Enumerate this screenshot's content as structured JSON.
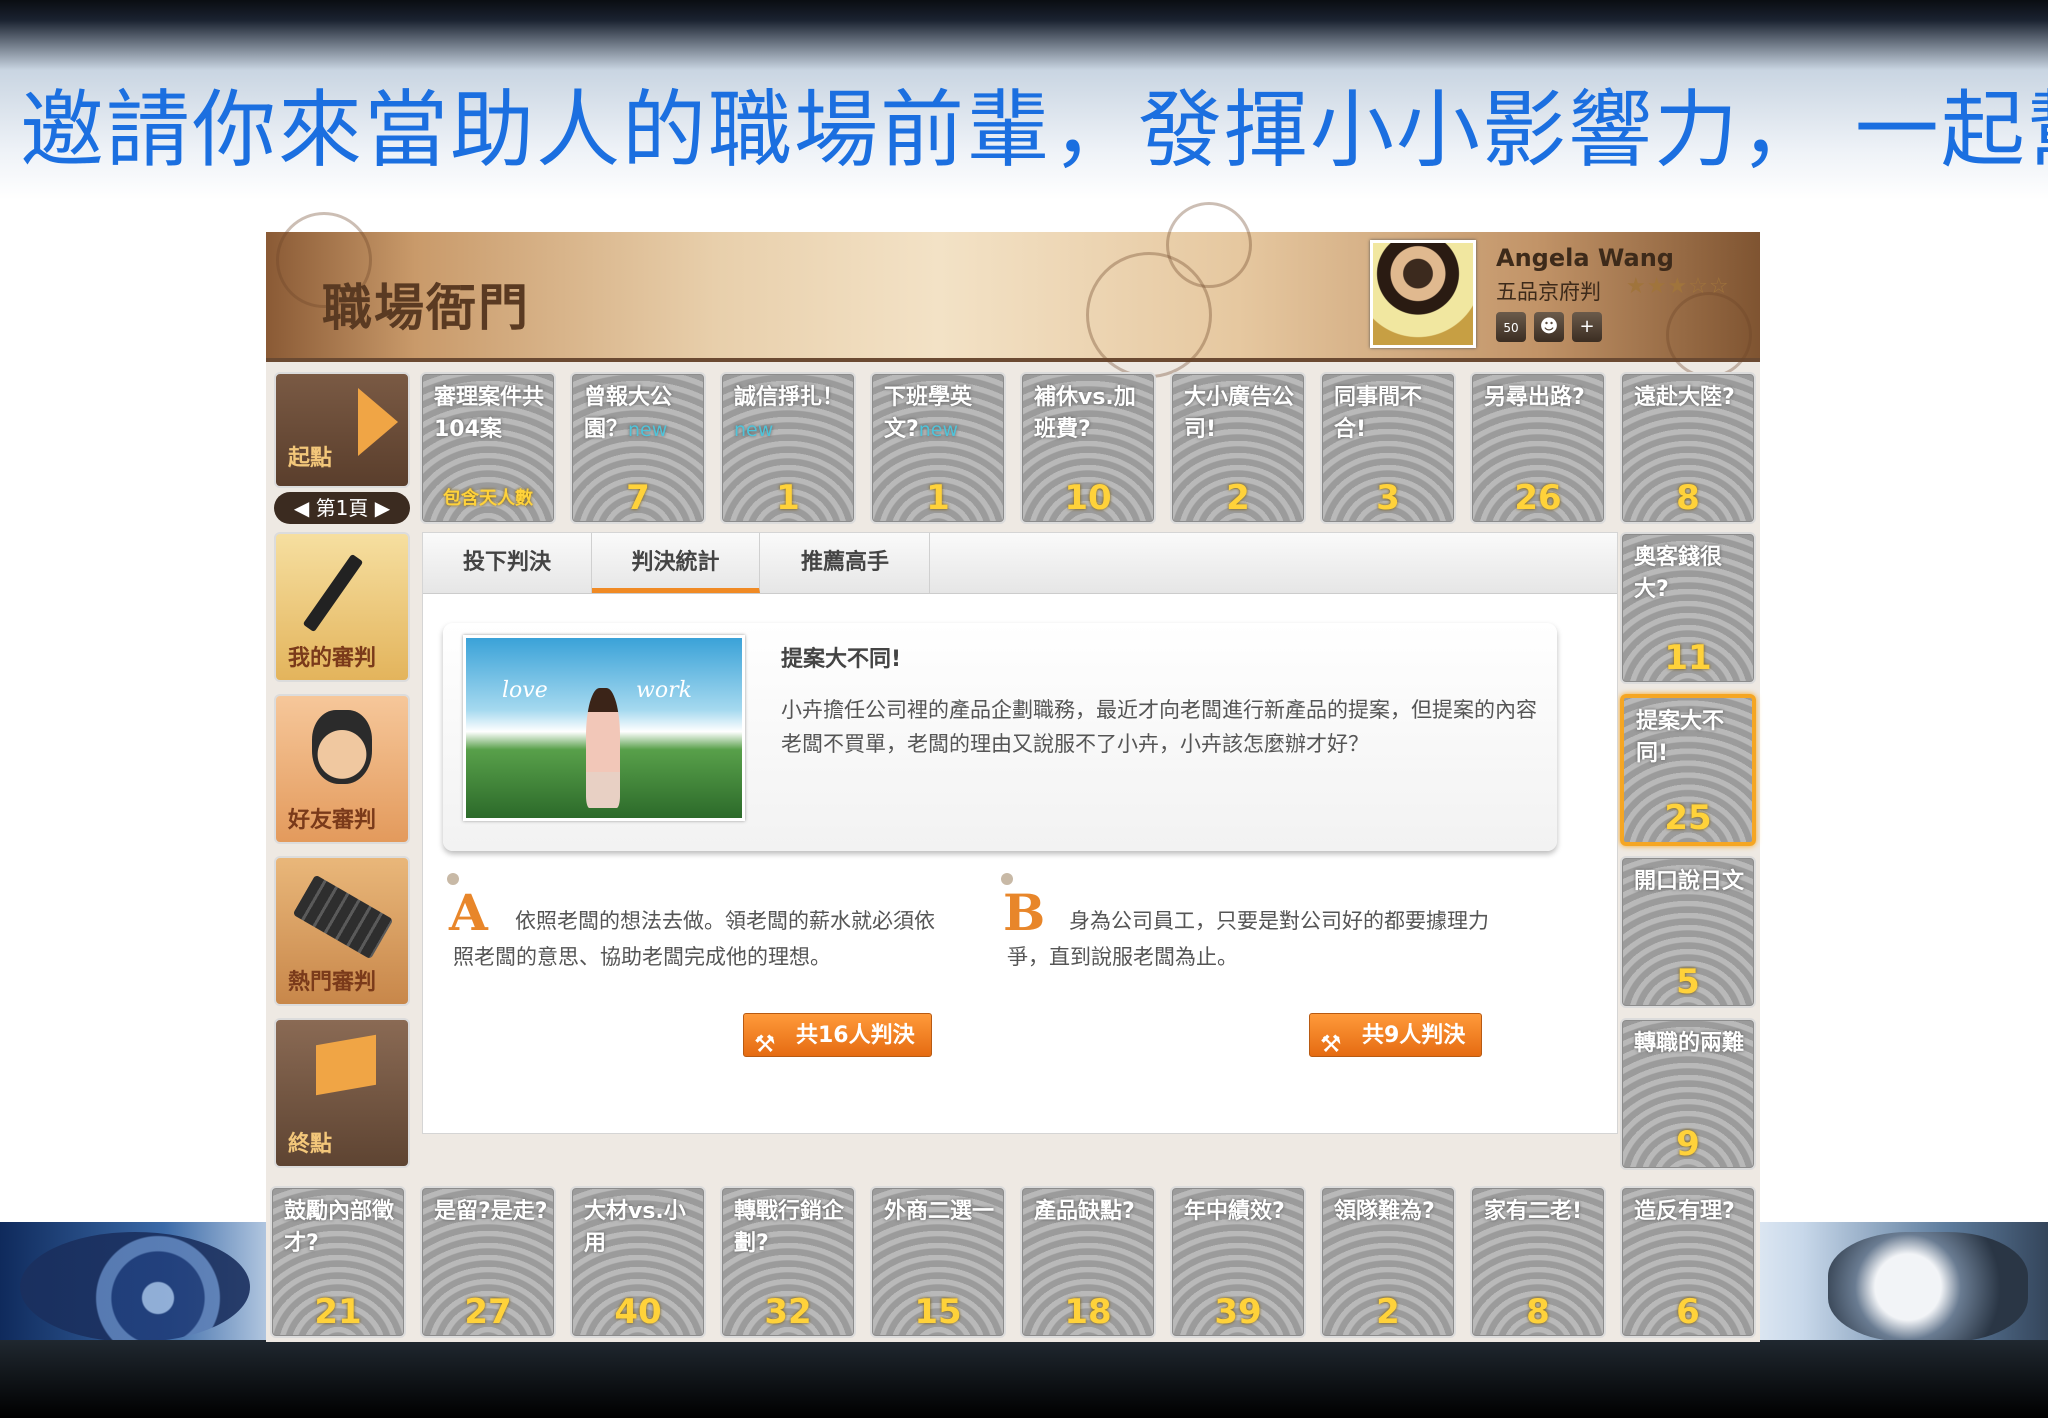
{
  "slide": {
    "title": "邀請你來當助人的職場前輩，發揮小小影響力， 一起幫"
  },
  "app": {
    "title": "職場衙門",
    "user": {
      "name": "Angela Wang",
      "rank": "五品京府判",
      "stars": "★★★☆☆",
      "badge_count": "50"
    },
    "user_icons": [
      "badge-icon",
      "friends-icon",
      "add-icon"
    ]
  },
  "start": {
    "label": "起點",
    "pager": "◀ 第1頁 ▶"
  },
  "side_menu": [
    {
      "label": "我的審判",
      "icon": "brush-icon"
    },
    {
      "label": "好友審判",
      "icon": "friend-avatar-icon"
    },
    {
      "label": "熱門審判",
      "icon": "bamboo-icon"
    },
    {
      "label": "終點",
      "icon": "flag-icon"
    }
  ],
  "top_tiles": [
    {
      "title": "審理案件共104案",
      "sub": "包含天人數",
      "count": ""
    },
    {
      "title": "曾報大公園？",
      "new": "new",
      "count": "7"
    },
    {
      "title": "誠信掙扎！",
      "new": "new",
      "count": "1"
    },
    {
      "title": "下班學英文?",
      "new": "new",
      "count": "1"
    },
    {
      "title": "補休vs.加班費?",
      "new": "",
      "count": "10"
    },
    {
      "title": "大小廣告公司!",
      "new": "",
      "count": "2"
    },
    {
      "title": "同事間不合!",
      "new": "",
      "count": "3"
    },
    {
      "title": "另尋出路?",
      "new": "",
      "count": "26"
    },
    {
      "title": "遠赴大陸?",
      "new": "",
      "count": "8"
    }
  ],
  "right_tiles": [
    {
      "title": "奧客錢很大?",
      "count": "11"
    },
    {
      "title": "提案大不同!",
      "count": "25"
    },
    {
      "title": "開口說日文",
      "count": "5"
    },
    {
      "title": "轉職的兩難",
      "count": "9"
    }
  ],
  "bottom_tiles": [
    {
      "title": "鼓勵內部徵才?",
      "count": "21"
    },
    {
      "title": "是留?是走?",
      "count": "27"
    },
    {
      "title": "大材vs.小用",
      "count": "40"
    },
    {
      "title": "轉戰行銷企劃?",
      "count": "32"
    },
    {
      "title": "外商二選一",
      "count": "15"
    },
    {
      "title": "產品缺點?",
      "count": "18"
    },
    {
      "title": "年中績效?",
      "count": "39"
    },
    {
      "title": "領隊難為?",
      "count": "2"
    },
    {
      "title": "家有二老!",
      "count": "8"
    },
    {
      "title": "造反有理?",
      "count": "6"
    }
  ],
  "tabs": [
    "投下判決",
    "判決統計",
    "推薦高手"
  ],
  "case": {
    "title": "提案大不同!",
    "description": "小卉擔任公司裡的產品企劃職務，最近才向老闆進行新產品的提案，但提案的內容老闆不買單，老闆的理由又說服不了小卉，小卉該怎麼辦才好？",
    "photo_words": [
      "love",
      "work"
    ]
  },
  "options": [
    {
      "letter": "A",
      "text": "依照老闆的想法去做。領老闆的薪水就必須依照老闆的意思、協助老闆完成他的理想。",
      "button": "共16人判決"
    },
    {
      "letter": "B",
      "text": "身為公司員工，只要是對公司好的都要據理力爭，直到說服老闆為止。",
      "button": "共9人判決"
    }
  ],
  "colors": {
    "accent": "#f08a24",
    "title_blue": "#1b6fe0",
    "count_yellow": "#ffd23a",
    "new_cyan": "#4fc3d9"
  }
}
